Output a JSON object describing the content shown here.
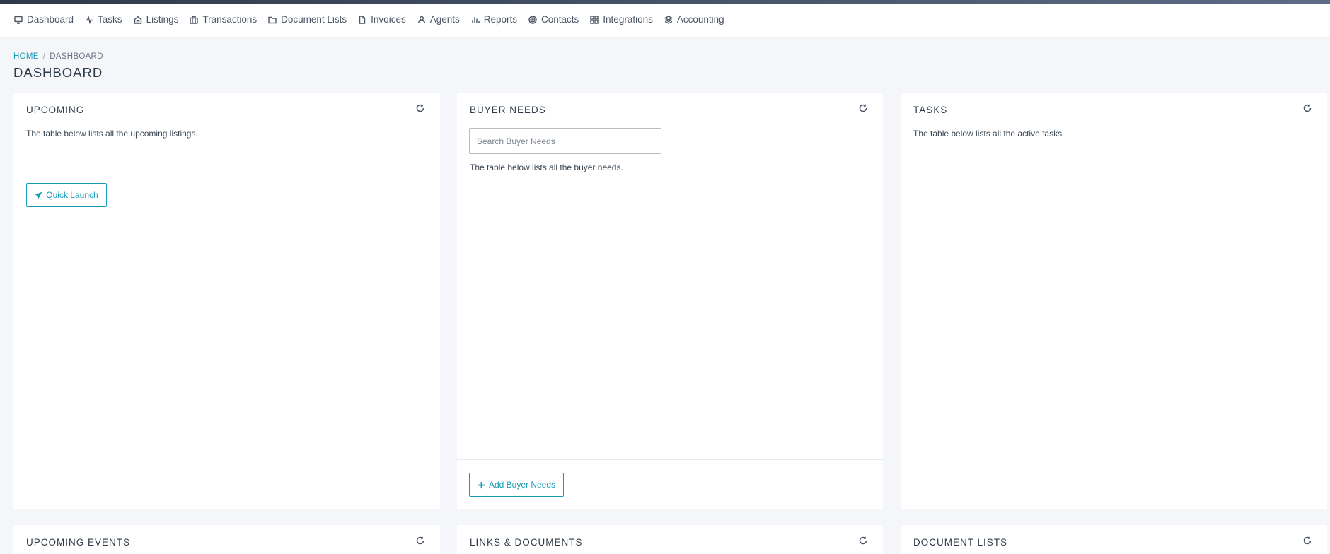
{
  "nav": [
    {
      "label": "Dashboard",
      "icon": "monitor-icon"
    },
    {
      "label": "Tasks",
      "icon": "activity-icon"
    },
    {
      "label": "Listings",
      "icon": "home-icon"
    },
    {
      "label": "Transactions",
      "icon": "briefcase-icon"
    },
    {
      "label": "Document Lists",
      "icon": "folder-icon"
    },
    {
      "label": "Invoices",
      "icon": "file-icon"
    },
    {
      "label": "Agents",
      "icon": "user-icon"
    },
    {
      "label": "Reports",
      "icon": "bar-chart-icon"
    },
    {
      "label": "Contacts",
      "icon": "target-icon"
    },
    {
      "label": "Integrations",
      "icon": "grid-icon"
    },
    {
      "label": "Accounting",
      "icon": "layers-icon"
    }
  ],
  "breadcrumb": {
    "home": "HOME",
    "separator": "/",
    "current": "DASHBOARD"
  },
  "page_title": "DASHBOARD",
  "cards": {
    "upcoming": {
      "title": "UPCOMING",
      "desc": "The table below lists all the upcoming listings.",
      "button": "Quick Launch"
    },
    "buyer_needs": {
      "title": "BUYER NEEDS",
      "search_placeholder": "Search Buyer Needs",
      "desc": "The table below lists all the buyer needs.",
      "button": "Add Buyer Needs"
    },
    "tasks": {
      "title": "TASKS",
      "desc": "The table below lists all the active tasks."
    },
    "upcoming_events": {
      "title": "UPCOMING EVENTS"
    },
    "links_documents": {
      "title": "LINKS & DOCUMENTS"
    },
    "document_lists": {
      "title": "DOCUMENT LISTS"
    }
  },
  "colors": {
    "accent": "#1a9bb5",
    "background": "#f4f6f9",
    "topbar_stripe": "#4a5568"
  }
}
